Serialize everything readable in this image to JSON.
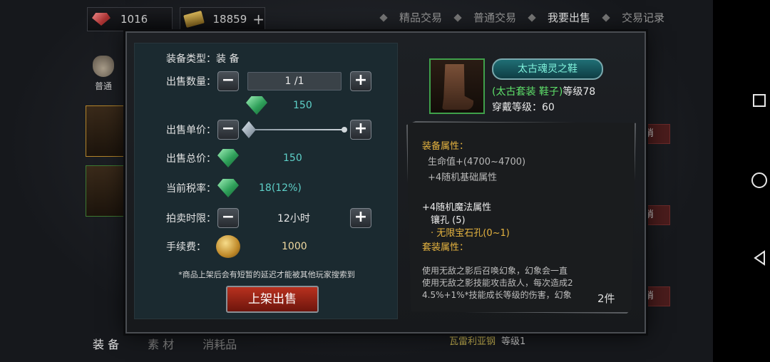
{
  "topbar": {
    "gem_count": "1016",
    "ticket_count": "18859",
    "add_symbol": "+",
    "tabs": [
      {
        "label": "精品交易",
        "active": false
      },
      {
        "label": "普通交易",
        "active": false
      },
      {
        "label": "我要出售",
        "active": true
      },
      {
        "label": "交易记录",
        "active": false
      }
    ]
  },
  "sidebar": {
    "category_label": "普通"
  },
  "bottom_tabs": [
    {
      "label": "装 备",
      "active": true
    },
    {
      "label": "素 材",
      "active": false
    },
    {
      "label": "消耗品",
      "active": false
    }
  ],
  "bottom_item": {
    "name": "瓦雷利亚钢",
    "level": "等级1"
  },
  "background_buttons": [
    "销",
    "销",
    "销"
  ],
  "sell_form": {
    "equip_type_label": "装备类型：",
    "equip_type_value": "装 备",
    "quantity_label": "出售数量：",
    "quantity_value": "1 /1",
    "unit_price_value": "150",
    "unit_price_label": "出售单价：",
    "total_price_label": "出售总价：",
    "total_price_value": "150",
    "tax_label": "当前税率：",
    "tax_value": "18(12%)",
    "duration_label": "拍卖时限：",
    "duration_value": "12小时",
    "fee_label": "手续费：",
    "fee_value": "1000",
    "note": "*商品上架后会有短暂的延迟才能被其他玩家搜索到",
    "sell_button": "上架出售",
    "minus": "−",
    "plus": "+"
  },
  "item": {
    "name": "太古魂灵之鞋",
    "set_label": "(太古套装 鞋子)",
    "level": "等级78",
    "wear_level": "穿戴等级：60",
    "equip_attr_head": "装备属性：",
    "hp_line": "生命值+(4700~4700)",
    "base_attr_line": "+4随机基础属性",
    "magic_attr_line": "+4随机魔法属性",
    "socket_line": "镶孔 (5)",
    "socket_sub": "· 无限宝石孔(0~1)",
    "set_attr_head": "套装属性：",
    "desc_1": "使用无敌之影后召唤幻象，幻象会一直",
    "desc_2": "使用无敌之影技能攻击敌人，每次造成2",
    "desc_3": "4.5%+1%*技能成长等级的伤害，幻象",
    "set_count": "2件"
  },
  "colors": {
    "accent_cyan": "#5ed0c8",
    "set_green": "#5ee06a",
    "attr_gold": "#e6b440",
    "sell_button_red": "#b8311f"
  }
}
